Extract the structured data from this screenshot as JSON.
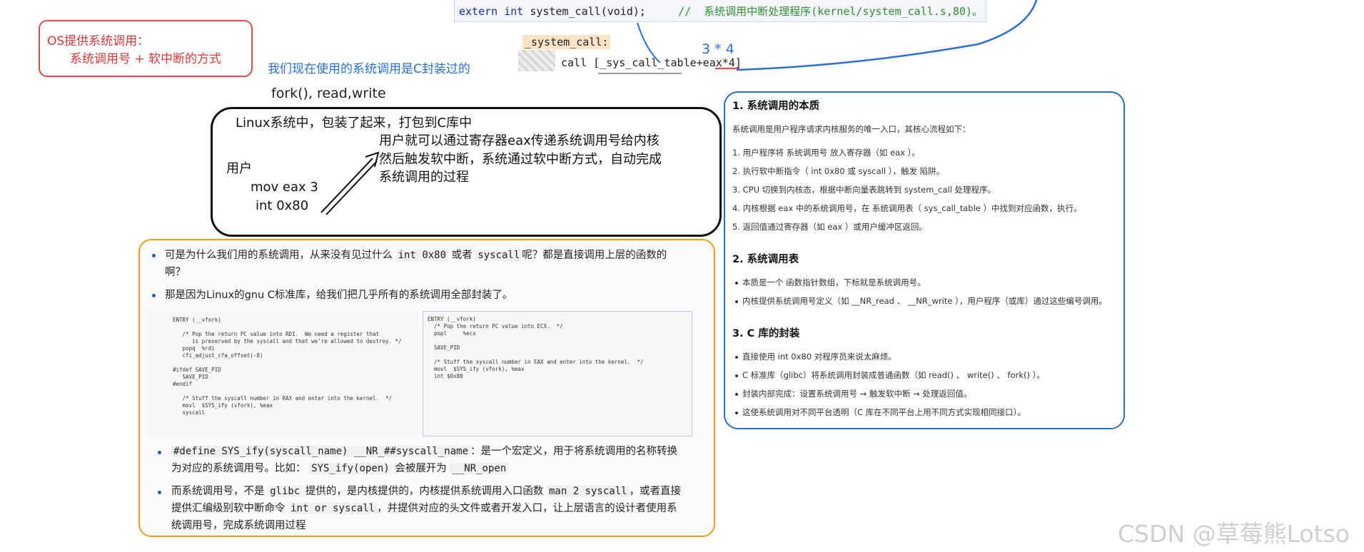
{
  "top_code": {
    "keyword": "extern int",
    "decl": " system_call(void);",
    "comment": "//  系统调用中断处理程序(kernel/system_call.s,80)。"
  },
  "red_note": {
    "line1": "OS提供系统调用：",
    "line2": "系统调用号 + 软中断的方式"
  },
  "blue_note": "我们现在使用的系统调用是C封装过的",
  "fork_line": "fork(), read,write",
  "system_call_code": {
    "label": "_system_call:",
    "call": "call [_sys_call_table+eax*4]",
    "multiplier": "3 * 4"
  },
  "black_box": {
    "title": "Linux系统中，包装了起来，打包到C库中",
    "line1": "用户就可以通过寄存器eax传递系统调用号给内核",
    "line2": "然后触发软中断，系统通过软中断方式，自动完成",
    "line3": "系统调用的过程",
    "user": "用户",
    "mov": "mov eax 3",
    "int": "int 0x80"
  },
  "orange_panel": {
    "b1_text_a": "可是为什么我们用的系统调用，从来没有见过什么",
    "b1_code1": "int 0x80",
    "b1_text_b": "或者",
    "b1_code2": "syscall",
    "b1_text_c": "呢？都是直接调用上层的函数的",
    "b1_text_d": "啊？",
    "b2": "那是因为Linux的gnu C标准库，给我们把几乎所有的系统调用全部封装了。",
    "shot_left": "ENTRY (__vfork)\n\n   /* Pop the return PC value into RDI.  We need a register that\n      is preserved by the syscall and that we're allowed to destroy. */\n   popq  %rdi\n   cfi_adjust_cfa_offset(-8)\n\n#ifdef SAVE_PID\n   SAVE_PID\n#endif\n\n   /* Stuff the syscall number in RAX and enter into the kernel.  */\n   movl  $SYS_ify (vfork), %eax\n   syscall",
    "shot_right": "ENTRY (__vfork)\n  /* Pop the return PC value into ECX.  */\n  popl     %ecx\n\n  SAVE_PID\n\n  /* Stuff the syscall number in EAX and enter into the kernel.  */\n  movl  $SYS_ify (vfork), %eax\n  int $0x80",
    "b3_code": "#define SYS_ify(syscall_name) __NR_##syscall_name",
    "b3_text_a": "：是一个宏定义，用于将系统调用的名称转换",
    "b3_text_b": "为对应的系统调用号。比如：",
    "b3_code2": "SYS_ify(open)",
    "b3_text_c": "会被展开为",
    "b3_code3": "__NR_open",
    "b4_text_a": "而系统调用号，不是",
    "b4_code1": "glibc",
    "b4_text_b": "提供的，是内核提供的，内核提供系统调用入口函数",
    "b4_code2": "man 2 syscall",
    "b4_text_c": "，或者直接",
    "b4_text_d": "提供汇编级别软中断命令",
    "b4_code3": "int or syscall",
    "b4_text_e": "，并提供对应的头文件或者开发入口，让上层语言的设计者使用系",
    "b4_text_f": "统调用号，完成系统调用过程"
  },
  "blue_panel": {
    "s1_title": "1. 系统调用的本质",
    "s1_intro": "系统调用是用户程序请求内核服务的唯一入口，其核心流程如下：",
    "s1_items": [
      "1. 用户程序将 系统调用号 放入寄存器（如 eax ）。",
      "2. 执行软中断指令（ int 0x80 或 syscall ），触发 陷阱。",
      "3. CPU 切换到内核态，根据中断向量表跳转到 system_call 处理程序。",
      "4. 内核根据 eax 中的系统调用号，在 系统调用表（ sys_call_table ）中找到对应函数，执行。",
      "5. 返回值通过寄存器（如 eax ）或用户缓冲区返回。"
    ],
    "s2_title": "2. 系统调用表",
    "s2_items": [
      "本质是一个 函数指针数组，下标就是系统调用号。",
      "内核提供系统调用号定义（如 __NR_read 、 __NR_write ），用户程序（或库）通过这些编号调用。"
    ],
    "s3_title": "3. C 库的封装",
    "s3_items": [
      "直接使用 int 0x80 对程序员来说太麻烦。",
      "C 标准库（glibc）将系统调用封装成普通函数（如 read() 、 write() 、 fork() ）。",
      "封装内部完成：设置系统调用号 → 触发软中断 → 处理返回值。",
      "这使系统调用对不同平台透明（C 库在不同平台上用不同方式实现相同接口）。"
    ]
  },
  "watermark": "CSDN @草莓熊Lotso"
}
